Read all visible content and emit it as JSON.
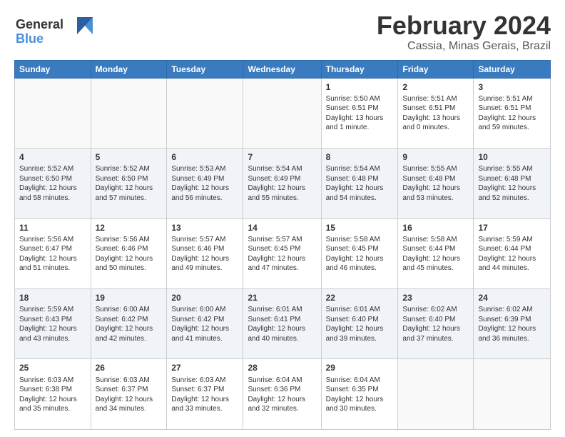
{
  "logo": {
    "line1": "General",
    "line2": "Blue"
  },
  "title": "February 2024",
  "location": "Cassia, Minas Gerais, Brazil",
  "weekdays": [
    "Sunday",
    "Monday",
    "Tuesday",
    "Wednesday",
    "Thursday",
    "Friday",
    "Saturday"
  ],
  "weeks": [
    [
      {
        "day": "",
        "info": ""
      },
      {
        "day": "",
        "info": ""
      },
      {
        "day": "",
        "info": ""
      },
      {
        "day": "",
        "info": ""
      },
      {
        "day": "1",
        "info": "Sunrise: 5:50 AM\nSunset: 6:51 PM\nDaylight: 13 hours and 1 minute."
      },
      {
        "day": "2",
        "info": "Sunrise: 5:51 AM\nSunset: 6:51 PM\nDaylight: 13 hours and 0 minutes."
      },
      {
        "day": "3",
        "info": "Sunrise: 5:51 AM\nSunset: 6:51 PM\nDaylight: 12 hours and 59 minutes."
      }
    ],
    [
      {
        "day": "4",
        "info": "Sunrise: 5:52 AM\nSunset: 6:50 PM\nDaylight: 12 hours and 58 minutes."
      },
      {
        "day": "5",
        "info": "Sunrise: 5:52 AM\nSunset: 6:50 PM\nDaylight: 12 hours and 57 minutes."
      },
      {
        "day": "6",
        "info": "Sunrise: 5:53 AM\nSunset: 6:49 PM\nDaylight: 12 hours and 56 minutes."
      },
      {
        "day": "7",
        "info": "Sunrise: 5:54 AM\nSunset: 6:49 PM\nDaylight: 12 hours and 55 minutes."
      },
      {
        "day": "8",
        "info": "Sunrise: 5:54 AM\nSunset: 6:48 PM\nDaylight: 12 hours and 54 minutes."
      },
      {
        "day": "9",
        "info": "Sunrise: 5:55 AM\nSunset: 6:48 PM\nDaylight: 12 hours and 53 minutes."
      },
      {
        "day": "10",
        "info": "Sunrise: 5:55 AM\nSunset: 6:48 PM\nDaylight: 12 hours and 52 minutes."
      }
    ],
    [
      {
        "day": "11",
        "info": "Sunrise: 5:56 AM\nSunset: 6:47 PM\nDaylight: 12 hours and 51 minutes."
      },
      {
        "day": "12",
        "info": "Sunrise: 5:56 AM\nSunset: 6:46 PM\nDaylight: 12 hours and 50 minutes."
      },
      {
        "day": "13",
        "info": "Sunrise: 5:57 AM\nSunset: 6:46 PM\nDaylight: 12 hours and 49 minutes."
      },
      {
        "day": "14",
        "info": "Sunrise: 5:57 AM\nSunset: 6:45 PM\nDaylight: 12 hours and 47 minutes."
      },
      {
        "day": "15",
        "info": "Sunrise: 5:58 AM\nSunset: 6:45 PM\nDaylight: 12 hours and 46 minutes."
      },
      {
        "day": "16",
        "info": "Sunrise: 5:58 AM\nSunset: 6:44 PM\nDaylight: 12 hours and 45 minutes."
      },
      {
        "day": "17",
        "info": "Sunrise: 5:59 AM\nSunset: 6:44 PM\nDaylight: 12 hours and 44 minutes."
      }
    ],
    [
      {
        "day": "18",
        "info": "Sunrise: 5:59 AM\nSunset: 6:43 PM\nDaylight: 12 hours and 43 minutes."
      },
      {
        "day": "19",
        "info": "Sunrise: 6:00 AM\nSunset: 6:42 PM\nDaylight: 12 hours and 42 minutes."
      },
      {
        "day": "20",
        "info": "Sunrise: 6:00 AM\nSunset: 6:42 PM\nDaylight: 12 hours and 41 minutes."
      },
      {
        "day": "21",
        "info": "Sunrise: 6:01 AM\nSunset: 6:41 PM\nDaylight: 12 hours and 40 minutes."
      },
      {
        "day": "22",
        "info": "Sunrise: 6:01 AM\nSunset: 6:40 PM\nDaylight: 12 hours and 39 minutes."
      },
      {
        "day": "23",
        "info": "Sunrise: 6:02 AM\nSunset: 6:40 PM\nDaylight: 12 hours and 37 minutes."
      },
      {
        "day": "24",
        "info": "Sunrise: 6:02 AM\nSunset: 6:39 PM\nDaylight: 12 hours and 36 minutes."
      }
    ],
    [
      {
        "day": "25",
        "info": "Sunrise: 6:03 AM\nSunset: 6:38 PM\nDaylight: 12 hours and 35 minutes."
      },
      {
        "day": "26",
        "info": "Sunrise: 6:03 AM\nSunset: 6:37 PM\nDaylight: 12 hours and 34 minutes."
      },
      {
        "day": "27",
        "info": "Sunrise: 6:03 AM\nSunset: 6:37 PM\nDaylight: 12 hours and 33 minutes."
      },
      {
        "day": "28",
        "info": "Sunrise: 6:04 AM\nSunset: 6:36 PM\nDaylight: 12 hours and 32 minutes."
      },
      {
        "day": "29",
        "info": "Sunrise: 6:04 AM\nSunset: 6:35 PM\nDaylight: 12 hours and 30 minutes."
      },
      {
        "day": "",
        "info": ""
      },
      {
        "day": "",
        "info": ""
      }
    ]
  ]
}
